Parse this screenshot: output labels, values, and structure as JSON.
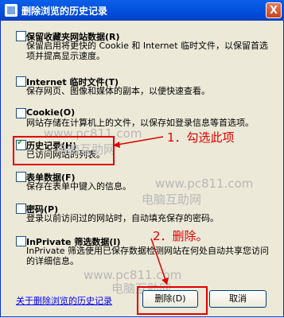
{
  "window": {
    "title": "删除浏览的历史记录",
    "close_label": "X"
  },
  "options": [
    {
      "title": "保留收藏夹网站数据(R)",
      "desc": "保留启用将更快的 Cookie 和 Internet 临时文件，以保留首选项并提高显示速度。",
      "checked": false
    },
    {
      "title": "Internet 临时文件(T)",
      "desc": "保存网页、图像和媒体的副本，以便快速查看。",
      "checked": false
    },
    {
      "title": "Cookie(O)",
      "desc": "网站存储在计算机上的文件，以保存如登录信息等首选项。",
      "checked": false
    },
    {
      "title": "历史记录(H)",
      "desc": "已访问网站的列表。",
      "checked": true
    },
    {
      "title": "表单数据(F)",
      "desc": "保存在表单中键入的信息。",
      "checked": false
    },
    {
      "title": "密码(P)",
      "desc": "登录以前访问过的网站时，自动填充保存的密码。",
      "checked": false
    },
    {
      "title": "InPrivate 筛选数据(I)",
      "desc": "InPrivate 筛选使用已保存数据检测网站在何处自动共享您访问的详细信息。",
      "checked": false
    }
  ],
  "footer": {
    "link": "关于删除浏览的历史记录",
    "delete_label": "删除(D)",
    "cancel_label": "取消"
  },
  "annotations": {
    "step1": "1．勾选此项",
    "step2": "2．删除。"
  },
  "watermarks": [
    "www.pc811.com",
    "电脑互助网"
  ],
  "colors": {
    "annotation": "#e00000",
    "titlebar": "#0454e0"
  }
}
